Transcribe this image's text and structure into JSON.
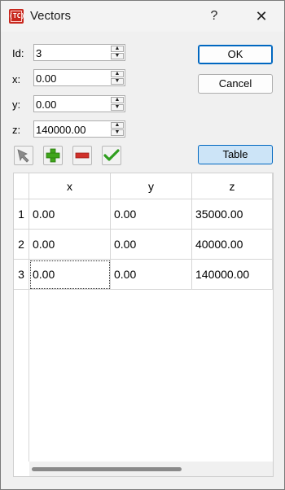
{
  "window": {
    "title": "Vectors",
    "icon_text": "(TC)",
    "help_label": "?",
    "close_label": "✕"
  },
  "fields": {
    "id": {
      "label": "Id:",
      "value": "3"
    },
    "x": {
      "label": "x:",
      "value": "0.00"
    },
    "y": {
      "label": "y:",
      "value": "0.00"
    },
    "z": {
      "label": "z:",
      "value": "140000.00"
    }
  },
  "buttons": {
    "ok": "OK",
    "cancel": "Cancel",
    "table": "Table"
  },
  "toolbar": {
    "icons": [
      "arrow-pointer-icon",
      "add-icon",
      "remove-icon",
      "check-icon"
    ],
    "colors": {
      "add": "#3fa51b",
      "remove": "#d0302a",
      "check": "#2f9e1f",
      "arrow": "#8a8a8a"
    }
  },
  "table": {
    "columns": [
      "x",
      "y",
      "z"
    ],
    "rows": [
      {
        "index": "1",
        "x": "0.00",
        "y": "0.00",
        "z": "35000.00"
      },
      {
        "index": "2",
        "x": "0.00",
        "y": "0.00",
        "z": "40000.00"
      },
      {
        "index": "3",
        "x": "0.00",
        "y": "0.00",
        "z": "140000.00"
      }
    ]
  }
}
